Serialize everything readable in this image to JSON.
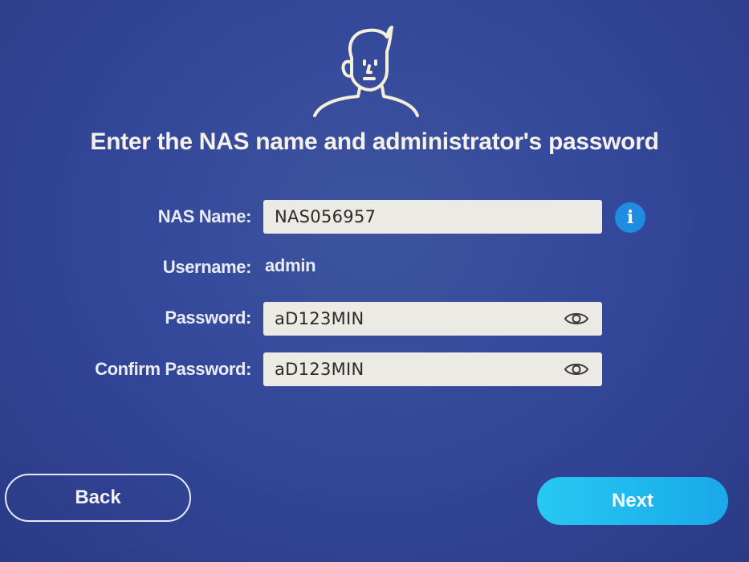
{
  "header": {
    "title": "Enter the NAS name and administrator's password",
    "avatar_icon": "user-avatar-icon"
  },
  "form": {
    "nas_name": {
      "label": "NAS Name:",
      "value": "NAS056957",
      "info_icon": "info-icon",
      "info_glyph": "i"
    },
    "username": {
      "label": "Username:",
      "value": "admin"
    },
    "password": {
      "label": "Password:",
      "value": "aD123MIN",
      "toggle_icon": "eye-icon"
    },
    "confirm_password": {
      "label": "Confirm Password:",
      "value": "aD123MIN",
      "toggle_icon": "eye-icon"
    }
  },
  "footer": {
    "back_label": "Back",
    "next_label": "Next"
  },
  "colors": {
    "background": "#34489a",
    "next_button": "#1aa8ea",
    "info_icon": "#1f8ce3",
    "field_background": "#eceae4"
  }
}
